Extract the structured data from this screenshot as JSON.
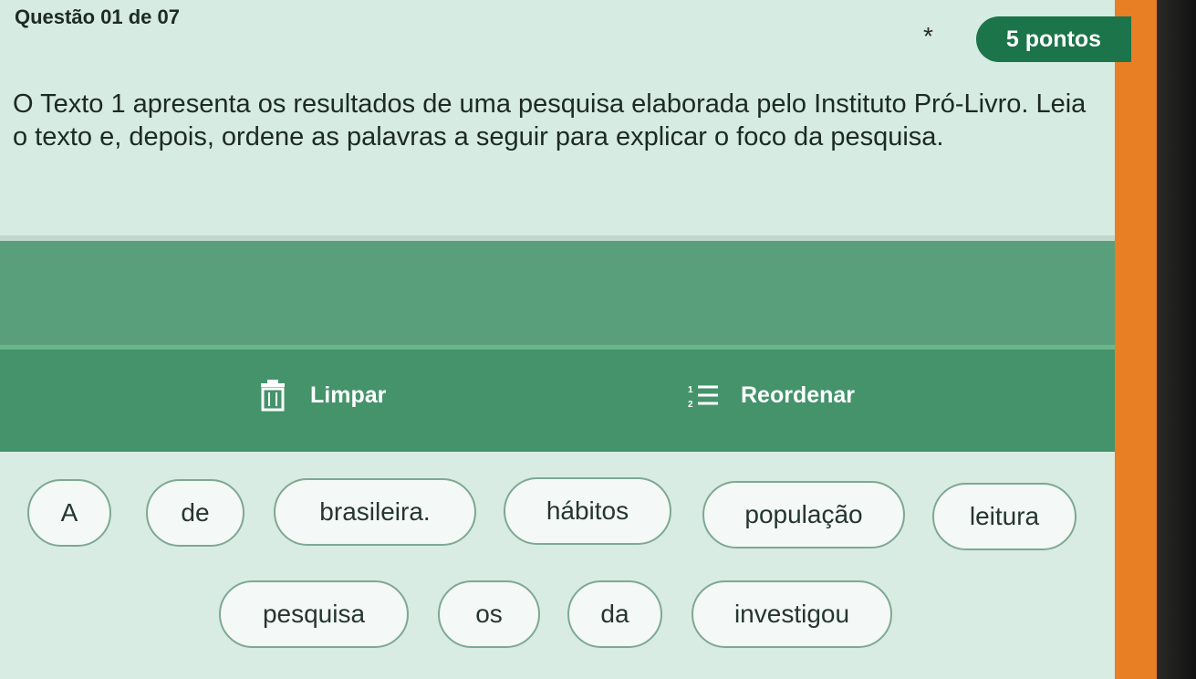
{
  "header": {
    "question_counter": "Questão 01 de 07",
    "required_marker": "*",
    "points": "5 pontos"
  },
  "question": {
    "prompt": "O Texto 1 apresenta os resultados de uma pesquisa elaborada pelo Instituto Pró-Livro. Leia o texto e, depois, ordene as palavras a seguir para explicar o foco da pesquisa."
  },
  "toolbar": {
    "clear_label": "Limpar",
    "reorder_label": "Reordenar",
    "clear_icon": "trash-icon",
    "reorder_icon": "numbered-list-icon"
  },
  "words": [
    "A",
    "de",
    "brasileira.",
    "hábitos",
    "população",
    "leitura",
    "pesquisa",
    "os",
    "da",
    "investigou"
  ],
  "colors": {
    "orange_frame": "#e87f25",
    "points_badge": "#1c744a",
    "toolbar_green": "#44936b",
    "light_panel": "#d6ebe2"
  }
}
